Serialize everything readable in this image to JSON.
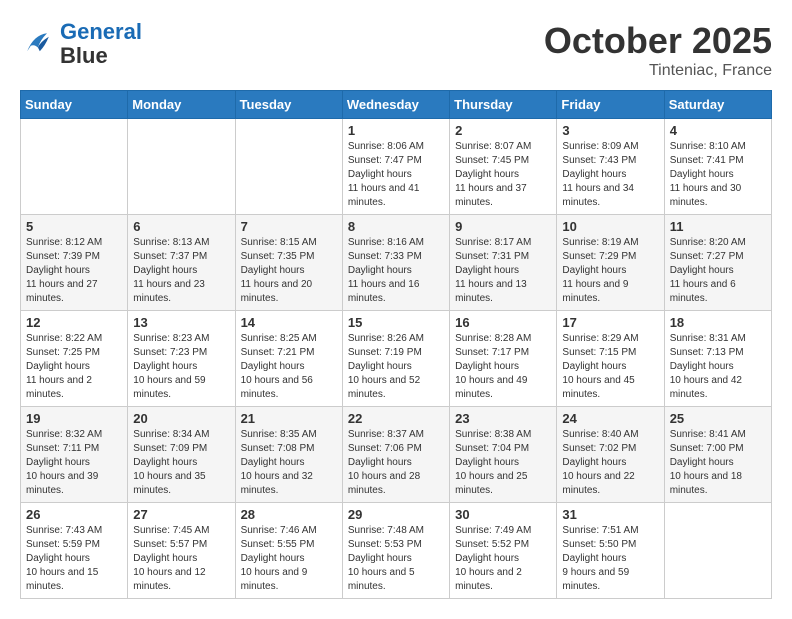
{
  "header": {
    "logo_line1": "General",
    "logo_line2": "Blue",
    "month": "October 2025",
    "location": "Tinteniac, France"
  },
  "weekdays": [
    "Sunday",
    "Monday",
    "Tuesday",
    "Wednesday",
    "Thursday",
    "Friday",
    "Saturday"
  ],
  "weeks": [
    [
      null,
      null,
      null,
      {
        "day": "1",
        "sunrise": "8:06 AM",
        "sunset": "7:47 PM",
        "daylight": "11 hours and 41 minutes."
      },
      {
        "day": "2",
        "sunrise": "8:07 AM",
        "sunset": "7:45 PM",
        "daylight": "11 hours and 37 minutes."
      },
      {
        "day": "3",
        "sunrise": "8:09 AM",
        "sunset": "7:43 PM",
        "daylight": "11 hours and 34 minutes."
      },
      {
        "day": "4",
        "sunrise": "8:10 AM",
        "sunset": "7:41 PM",
        "daylight": "11 hours and 30 minutes."
      }
    ],
    [
      {
        "day": "5",
        "sunrise": "8:12 AM",
        "sunset": "7:39 PM",
        "daylight": "11 hours and 27 minutes."
      },
      {
        "day": "6",
        "sunrise": "8:13 AM",
        "sunset": "7:37 PM",
        "daylight": "11 hours and 23 minutes."
      },
      {
        "day": "7",
        "sunrise": "8:15 AM",
        "sunset": "7:35 PM",
        "daylight": "11 hours and 20 minutes."
      },
      {
        "day": "8",
        "sunrise": "8:16 AM",
        "sunset": "7:33 PM",
        "daylight": "11 hours and 16 minutes."
      },
      {
        "day": "9",
        "sunrise": "8:17 AM",
        "sunset": "7:31 PM",
        "daylight": "11 hours and 13 minutes."
      },
      {
        "day": "10",
        "sunrise": "8:19 AM",
        "sunset": "7:29 PM",
        "daylight": "11 hours and 9 minutes."
      },
      {
        "day": "11",
        "sunrise": "8:20 AM",
        "sunset": "7:27 PM",
        "daylight": "11 hours and 6 minutes."
      }
    ],
    [
      {
        "day": "12",
        "sunrise": "8:22 AM",
        "sunset": "7:25 PM",
        "daylight": "11 hours and 2 minutes."
      },
      {
        "day": "13",
        "sunrise": "8:23 AM",
        "sunset": "7:23 PM",
        "daylight": "10 hours and 59 minutes."
      },
      {
        "day": "14",
        "sunrise": "8:25 AM",
        "sunset": "7:21 PM",
        "daylight": "10 hours and 56 minutes."
      },
      {
        "day": "15",
        "sunrise": "8:26 AM",
        "sunset": "7:19 PM",
        "daylight": "10 hours and 52 minutes."
      },
      {
        "day": "16",
        "sunrise": "8:28 AM",
        "sunset": "7:17 PM",
        "daylight": "10 hours and 49 minutes."
      },
      {
        "day": "17",
        "sunrise": "8:29 AM",
        "sunset": "7:15 PM",
        "daylight": "10 hours and 45 minutes."
      },
      {
        "day": "18",
        "sunrise": "8:31 AM",
        "sunset": "7:13 PM",
        "daylight": "10 hours and 42 minutes."
      }
    ],
    [
      {
        "day": "19",
        "sunrise": "8:32 AM",
        "sunset": "7:11 PM",
        "daylight": "10 hours and 39 minutes."
      },
      {
        "day": "20",
        "sunrise": "8:34 AM",
        "sunset": "7:09 PM",
        "daylight": "10 hours and 35 minutes."
      },
      {
        "day": "21",
        "sunrise": "8:35 AM",
        "sunset": "7:08 PM",
        "daylight": "10 hours and 32 minutes."
      },
      {
        "day": "22",
        "sunrise": "8:37 AM",
        "sunset": "7:06 PM",
        "daylight": "10 hours and 28 minutes."
      },
      {
        "day": "23",
        "sunrise": "8:38 AM",
        "sunset": "7:04 PM",
        "daylight": "10 hours and 25 minutes."
      },
      {
        "day": "24",
        "sunrise": "8:40 AM",
        "sunset": "7:02 PM",
        "daylight": "10 hours and 22 minutes."
      },
      {
        "day": "25",
        "sunrise": "8:41 AM",
        "sunset": "7:00 PM",
        "daylight": "10 hours and 18 minutes."
      }
    ],
    [
      {
        "day": "26",
        "sunrise": "7:43 AM",
        "sunset": "5:59 PM",
        "daylight": "10 hours and 15 minutes."
      },
      {
        "day": "27",
        "sunrise": "7:45 AM",
        "sunset": "5:57 PM",
        "daylight": "10 hours and 12 minutes."
      },
      {
        "day": "28",
        "sunrise": "7:46 AM",
        "sunset": "5:55 PM",
        "daylight": "10 hours and 9 minutes."
      },
      {
        "day": "29",
        "sunrise": "7:48 AM",
        "sunset": "5:53 PM",
        "daylight": "10 hours and 5 minutes."
      },
      {
        "day": "30",
        "sunrise": "7:49 AM",
        "sunset": "5:52 PM",
        "daylight": "10 hours and 2 minutes."
      },
      {
        "day": "31",
        "sunrise": "7:51 AM",
        "sunset": "5:50 PM",
        "daylight": "9 hours and 59 minutes."
      },
      null
    ]
  ]
}
